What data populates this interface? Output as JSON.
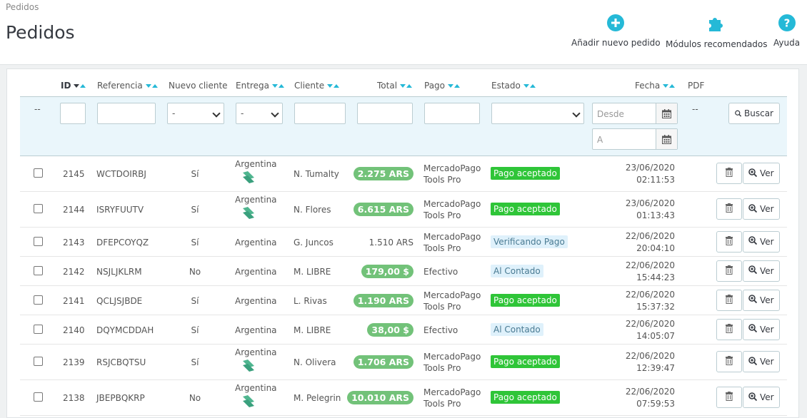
{
  "breadcrumb": "Pedidos",
  "title": "Pedidos",
  "toolbar": {
    "add_order": "Añadir nuevo pedido",
    "modules": "Módulos recomendados",
    "help": "Ayuda"
  },
  "colors": {
    "accent": "#25b9d7",
    "success": "#2fc538",
    "total_badge": "#72c279",
    "info_bg": "#dff1fb"
  },
  "columns": {
    "id": "ID",
    "reference": "Referencia",
    "new_client": "Nuevo cliente",
    "delivery": "Entrega",
    "client": "Cliente",
    "total": "Total",
    "payment": "Pago",
    "status": "Estado",
    "date": "Fecha",
    "pdf": "PDF"
  },
  "filters": {
    "dash": "--",
    "new_client_value": "-",
    "delivery_value": "-",
    "date_from_placeholder": "Desde",
    "date_to_placeholder": "A",
    "pdf_dash": "--",
    "search_button": "Buscar"
  },
  "rows": [
    {
      "id": "2145",
      "ref": "WCTDOIRBJ",
      "new": "Sí",
      "delivery": "Argentina",
      "ship_icon": true,
      "client": "N. Tumalty",
      "total": "2.275 ARS",
      "total_badge": true,
      "pay1": "MercadoPago",
      "pay2": "Tools Pro",
      "status": "Pago aceptado",
      "status_type": "green",
      "date": "23/06/2020",
      "time": "02:11:53",
      "ver": "Ver"
    },
    {
      "id": "2144",
      "ref": "ISRYFUUTV",
      "new": "Sí",
      "delivery": "Argentina",
      "ship_icon": true,
      "client": "N. Flores",
      "total": "6.615 ARS",
      "total_badge": true,
      "pay1": "MercadoPago",
      "pay2": "Tools Pro",
      "status": "Pago aceptado",
      "status_type": "green",
      "date": "23/06/2020",
      "time": "01:13:43",
      "ver": "Ver"
    },
    {
      "id": "2143",
      "ref": "DFEPCOYQZ",
      "new": "Sí",
      "delivery": "Argentina",
      "ship_icon": false,
      "client": "G. Juncos",
      "total": "1.510 ARS",
      "total_badge": false,
      "pay1": "MercadoPago",
      "pay2": "Tools Pro",
      "status": "Verificando Pago",
      "status_type": "blue",
      "date": "22/06/2020",
      "time": "20:04:10",
      "ver": "Ver"
    },
    {
      "id": "2142",
      "ref": "NSJLJKLRM",
      "new": "No",
      "delivery": "Argentina",
      "ship_icon": false,
      "client": "M. LIBRE",
      "total": "179,00 $",
      "total_badge": true,
      "pay1": "Efectivo",
      "pay2": "",
      "status": "Al Contado",
      "status_type": "blue",
      "date": "22/06/2020",
      "time": "15:44:23",
      "ver": "Ver"
    },
    {
      "id": "2141",
      "ref": "QCLJSJBDE",
      "new": "Sí",
      "delivery": "Argentina",
      "ship_icon": false,
      "client": "L. Rivas",
      "total": "1.190 ARS",
      "total_badge": true,
      "pay1": "MercadoPago",
      "pay2": "Tools Pro",
      "status": "Pago aceptado",
      "status_type": "green",
      "date": "22/06/2020",
      "time": "15:37:32",
      "ver": "Ver"
    },
    {
      "id": "2140",
      "ref": "DQYMCDDAH",
      "new": "Sí",
      "delivery": "Argentina",
      "ship_icon": false,
      "client": "M. LIBRE",
      "total": "38,00 $",
      "total_badge": true,
      "pay1": "Efectivo",
      "pay2": "",
      "status": "Al Contado",
      "status_type": "blue",
      "date": "22/06/2020",
      "time": "14:05:07",
      "ver": "Ver"
    },
    {
      "id": "2139",
      "ref": "RSJCBQTSU",
      "new": "Sí",
      "delivery": "Argentina",
      "ship_icon": true,
      "client": "N. Olivera",
      "total": "1.706 ARS",
      "total_badge": true,
      "pay1": "MercadoPago",
      "pay2": "Tools Pro",
      "status": "Pago aceptado",
      "status_type": "green",
      "date": "22/06/2020",
      "time": "12:39:47",
      "ver": "Ver"
    },
    {
      "id": "2138",
      "ref": "JBEPBQKRP",
      "new": "No",
      "delivery": "Argentina",
      "ship_icon": true,
      "client": "M. Pelegrin",
      "total": "10.010 ARS",
      "total_badge": true,
      "pay1": "MercadoPago",
      "pay2": "Tools Pro",
      "status": "Pago aceptado",
      "status_type": "green",
      "date": "22/06/2020",
      "time": "07:59:53",
      "ver": "Ver"
    }
  ]
}
